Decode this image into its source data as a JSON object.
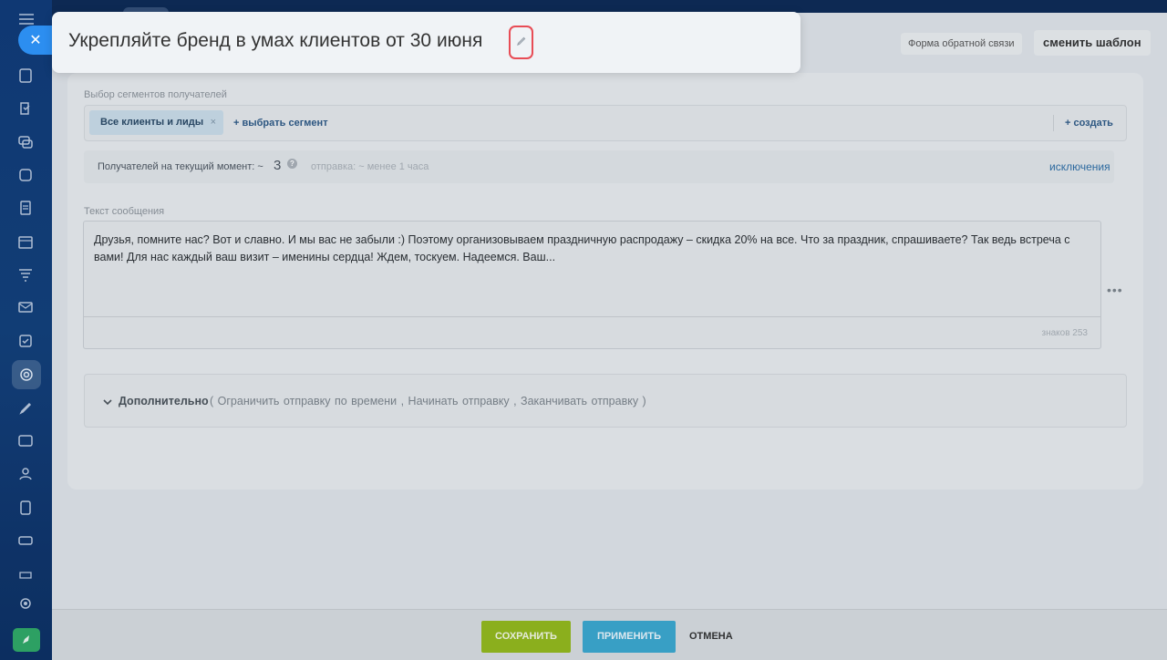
{
  "title": {
    "text": "Укрепляйте бренд в умах клиентов от 30 июня"
  },
  "header_buttons": {
    "feedback": "Форма обратной связи",
    "change_template": "сменить шаблон"
  },
  "segments": {
    "label": "Выбор сегментов получателей",
    "chip": "Все клиенты и лиды",
    "chip_remove": "×",
    "select_segment": "+ выбрать сегмент",
    "create": "+ создать"
  },
  "recipients": {
    "label": "Получателей на текущий момент: ~",
    "count": "3",
    "help": "?",
    "send_time": "отправка: ~ менее 1 часа",
    "exclusions": "исключения"
  },
  "message": {
    "label": "Текст сообщения",
    "text": "Друзья, помните нас? Вот и славно. И мы вас не забыли :) Поэтому организовываем праздничную распродажу – скидка 20% на все. Что за праздник, спрашиваете? Так ведь встреча с вами! Для нас каждый ваш визит – именины сердца! Ждем, тоскуем. Надеемся. Ваш...",
    "char_count": "знаков 253",
    "more": "•••"
  },
  "additional": {
    "title": "Дополнительно",
    "options": "( Ограничить отправку по времени ,  Начинать отправку ,  Заканчивать отправку  )"
  },
  "footer": {
    "save": "СОХРАНИТЬ",
    "apply": "ПРИМЕНИТЬ",
    "cancel": "ОТМЕНА"
  },
  "icons": {
    "close": "close-icon",
    "edit": "pencil-icon"
  },
  "colors": {
    "save": "#93b81c",
    "apply": "#3ba7cf",
    "close": "#2c8ef0",
    "highlight": "#e84c55"
  }
}
